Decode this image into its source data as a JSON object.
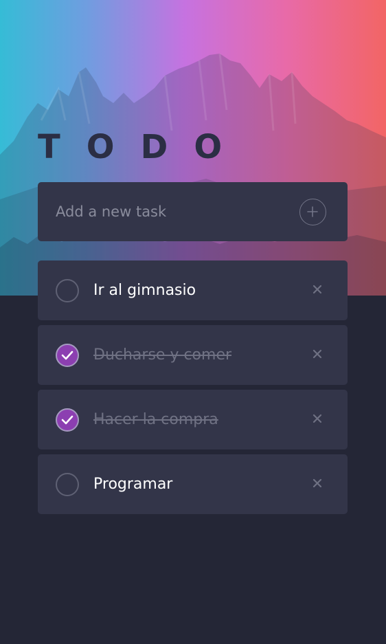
{
  "header": {
    "title": "TODO"
  },
  "new_task": {
    "placeholder": "Add a new task",
    "add_icon": "plus-circle-icon"
  },
  "tasks": [
    {
      "text": "Ir al gimnasio",
      "completed": false
    },
    {
      "text": "Ducharse y comer",
      "completed": true
    },
    {
      "text": "Hacer la compra",
      "completed": true
    },
    {
      "text": "Programar",
      "completed": false
    }
  ],
  "icons": {
    "check": "checkmark-icon",
    "delete": "close-icon"
  },
  "colors": {
    "background": "#242636",
    "card": "#333549",
    "accent_check": "#8c3fb1",
    "text_active": "#ffffff",
    "text_done": "#6f7183",
    "gradient": [
      "#35bcd6",
      "#c672e0",
      "#f26565"
    ]
  }
}
